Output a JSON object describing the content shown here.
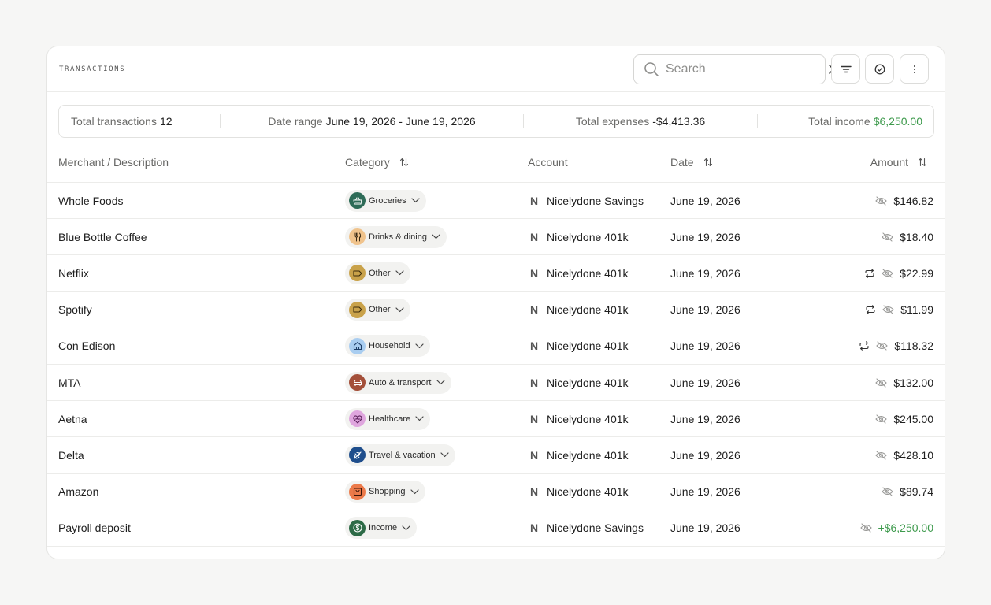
{
  "header": {
    "title": "TRANSACTIONS",
    "search_placeholder": "Search"
  },
  "summary": {
    "total_transactions_label": "Total transactions",
    "total_transactions_value": "12",
    "date_range_label": "Date range",
    "date_range_value": "June 19, 2026 - June 19, 2026",
    "total_expenses_label": "Total expenses",
    "total_expenses_value": "-$4,413.36",
    "total_income_label": "Total income",
    "total_income_value": "$6,250.00"
  },
  "columns": {
    "merchant": "Merchant / Description",
    "category": "Category",
    "account": "Account",
    "date": "Date",
    "amount": "Amount"
  },
  "colors": {
    "income_green": "#3d9a4c"
  },
  "rows": [
    {
      "merchant": "Whole Foods",
      "category": "Groceries",
      "cat_icon": "basket-icon",
      "cat_color": "#2d6b57",
      "account_initial": "N",
      "account": "Nicelydone Savings",
      "date": "June 19, 2026",
      "amount": "$146.82",
      "recurring": false,
      "income": false
    },
    {
      "merchant": "Blue Bottle Coffee",
      "category": "Drinks & dining",
      "cat_icon": "utensils-icon",
      "cat_color": "#f0c38c",
      "account_initial": "N",
      "account": "Nicelydone 401k",
      "date": "June 19, 2026",
      "amount": "$18.40",
      "recurring": false,
      "income": false
    },
    {
      "merchant": "Netflix",
      "category": "Other",
      "cat_icon": "tag-icon",
      "cat_color": "#c9a24a",
      "account_initial": "N",
      "account": "Nicelydone 401k",
      "date": "June 19, 2026",
      "amount": "$22.99",
      "recurring": true,
      "income": false
    },
    {
      "merchant": "Spotify",
      "category": "Other",
      "cat_icon": "tag-icon",
      "cat_color": "#c9a24a",
      "account_initial": "N",
      "account": "Nicelydone 401k",
      "date": "June 19, 2026",
      "amount": "$11.99",
      "recurring": true,
      "income": false
    },
    {
      "merchant": "Con Edison",
      "category": "Household",
      "cat_icon": "home-icon",
      "cat_color": "#a9cdf0",
      "account_initial": "N",
      "account": "Nicelydone 401k",
      "date": "June 19, 2026",
      "amount": "$118.32",
      "recurring": true,
      "income": false
    },
    {
      "merchant": "MTA",
      "category": "Auto & transport",
      "cat_icon": "car-icon",
      "cat_color": "#a4503a",
      "account_initial": "N",
      "account": "Nicelydone 401k",
      "date": "June 19, 2026",
      "amount": "$132.00",
      "recurring": false,
      "income": false
    },
    {
      "merchant": "Aetna",
      "category": "Healthcare",
      "cat_icon": "heart-pulse-icon",
      "cat_color": "#dfa6de",
      "account_initial": "N",
      "account": "Nicelydone 401k",
      "date": "June 19, 2026",
      "amount": "$245.00",
      "recurring": false,
      "income": false
    },
    {
      "merchant": "Delta",
      "category": "Travel & vacation",
      "cat_icon": "plane-icon",
      "cat_color": "#1f4e8c",
      "account_initial": "N",
      "account": "Nicelydone 401k",
      "date": "June 19, 2026",
      "amount": "$428.10",
      "recurring": false,
      "income": false
    },
    {
      "merchant": "Amazon",
      "category": "Shopping",
      "cat_icon": "shopping-bag-icon",
      "cat_color": "#ec7a4a",
      "account_initial": "N",
      "account": "Nicelydone 401k",
      "date": "June 19, 2026",
      "amount": "$89.74",
      "recurring": false,
      "income": false
    },
    {
      "merchant": "Payroll deposit",
      "category": "Income",
      "cat_icon": "dollar-coin-icon",
      "cat_color": "#2d6b47",
      "account_initial": "N",
      "account": "Nicelydone Savings",
      "date": "June 19, 2026",
      "amount": "+$6,250.00",
      "recurring": false,
      "income": true
    }
  ]
}
